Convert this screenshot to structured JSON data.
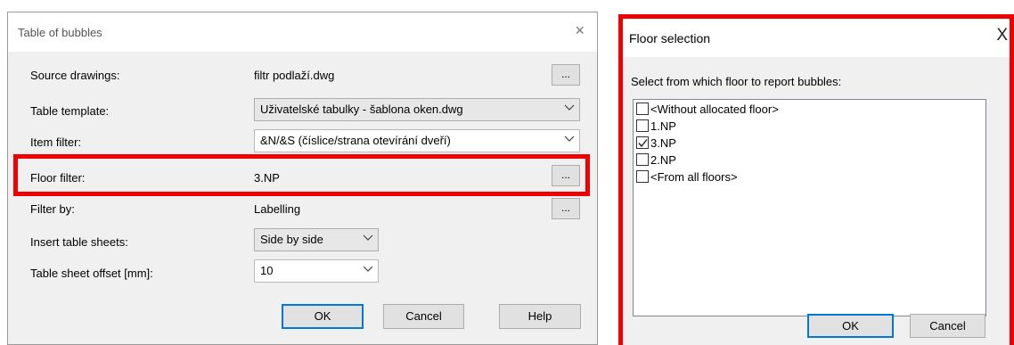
{
  "table_dialog": {
    "title": "Table of bubbles",
    "close_glyph": "×",
    "rows": {
      "source_drawings": {
        "label": "Source drawings:",
        "value": "filtr podlaží.dwg",
        "browse": "..."
      },
      "table_template": {
        "label": "Table template:",
        "value": "Uživatelské tabulky - šablona oken.dwg"
      },
      "item_filter": {
        "label": "Item filter:",
        "value": "&N/&S (číslice/strana otevírání dveří)"
      },
      "floor_filter": {
        "label": "Floor filter:",
        "value": "3.NP",
        "browse": "..."
      },
      "filter_by": {
        "label": "Filter by:",
        "value": "Labelling",
        "browse": "..."
      },
      "insert_table_sheets": {
        "label": "Insert table sheets:",
        "value": "Side by side"
      },
      "table_sheet_offset": {
        "label": "Table sheet offset [mm]:",
        "value": "10"
      }
    },
    "buttons": {
      "ok": "OK",
      "cancel": "Cancel",
      "help": "Help"
    }
  },
  "floor_dialog": {
    "title": "Floor selection",
    "close_glyph": "X",
    "prompt": "Select from which floor to report bubbles:",
    "items": [
      {
        "label": "<Without allocated floor>",
        "checked": false
      },
      {
        "label": "1.NP",
        "checked": false
      },
      {
        "label": "3.NP",
        "checked": true
      },
      {
        "label": "2.NP",
        "checked": false
      },
      {
        "label": "<From all floors>",
        "checked": false
      }
    ],
    "buttons": {
      "ok": "OK",
      "cancel": "Cancel"
    }
  },
  "colors": {
    "highlight": "#ee0000",
    "accent": "#0078d7",
    "dialog_bg": "#f0f0f0"
  }
}
